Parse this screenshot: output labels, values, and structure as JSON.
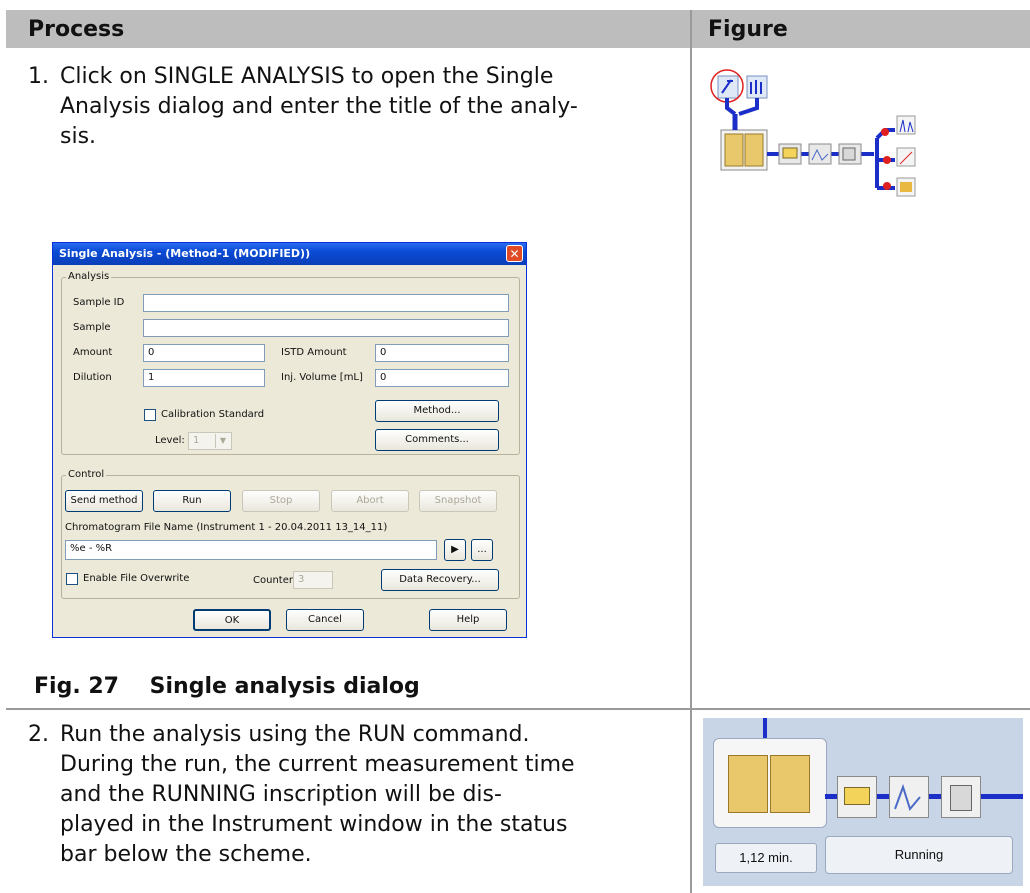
{
  "table": {
    "headers": [
      "Process",
      "Figure"
    ]
  },
  "steps": [
    {
      "number": "1.",
      "lines": [
        "Click on SINGLE ANALYSIS to open the Single",
        "Analysis dialog and enter the title of the analy-",
        "sis."
      ]
    },
    {
      "number": "2.",
      "lines": [
        "Run the analysis using the RUN command.",
        "During the run, the current measurement time",
        "and the RUNNING inscription will be dis-",
        "played in the Instrument window in the status",
        "bar below the scheme."
      ]
    }
  ],
  "dialog": {
    "title": "Single Analysis - (Method-1 (MODIFIED))",
    "analysis_group": "Analysis",
    "sample_id_label": "Sample ID",
    "sample_label": "Sample",
    "amount_label": "Amount",
    "amount_value": "0",
    "istd_label": "ISTD Amount",
    "istd_value": "0",
    "dilution_label": "Dilution",
    "dilution_value": "1",
    "inj_volume_label": "Inj. Volume [mL]",
    "inj_volume_value": "0",
    "calibration_label": "Calibration Standard",
    "level_label": "Level:",
    "level_value": "1",
    "method_button": "Method...",
    "comments_button": "Comments...",
    "control_group": "Control",
    "send_method_button": "Send method",
    "run_button": "Run",
    "stop_button": "Stop",
    "abort_button": "Abort",
    "snapshot_button": "Snapshot",
    "file_name_label": "Chromatogram File Name (Instrument 1 - 20.04.2011 13_14_11)",
    "file_name_value": "%e - %R",
    "browse_button": "...",
    "overwrite_label": "Enable File Overwrite",
    "counter_label": "Counter",
    "counter_value": "3",
    "data_recovery_button": "Data Recovery...",
    "ok_button": "OK",
    "cancel_button": "Cancel",
    "help_button": "Help"
  },
  "caption": {
    "number": "Fig. 27",
    "text": "Single analysis dialog"
  },
  "status_bar": {
    "time": "1,12 min.",
    "state": "Running"
  },
  "colors": {
    "header_bg": "#bdbdbd",
    "pipe_blue": "#1b2fc8",
    "node_red": "#e02020"
  }
}
